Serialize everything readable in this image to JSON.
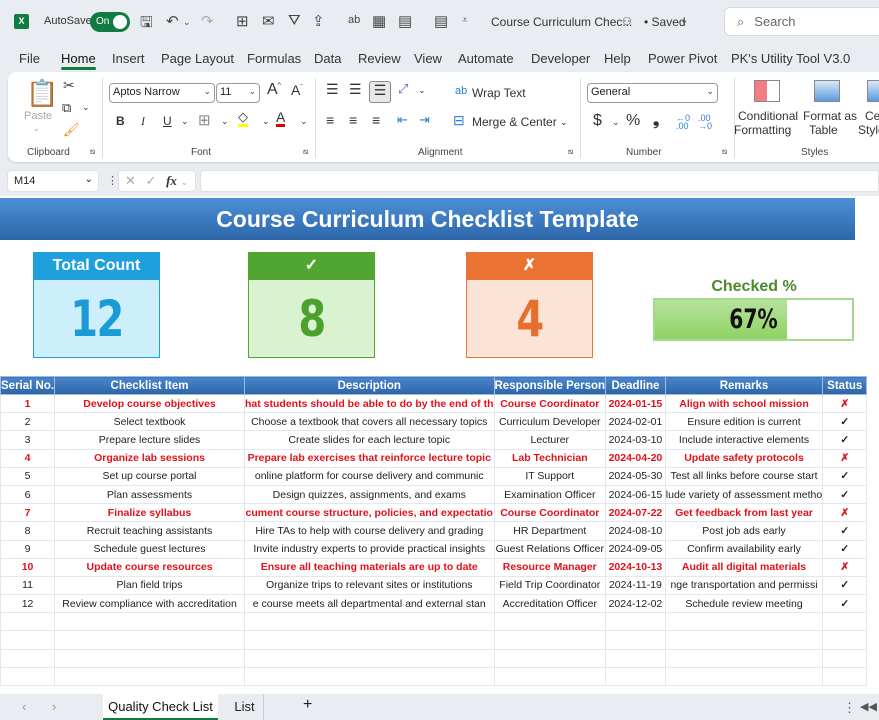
{
  "titlebar": {
    "app_logo": "X",
    "autosave_label": "AutoSave",
    "autosave_state": "On",
    "doc_title": "Course Curriculum Chec...",
    "saved_label": "• Saved",
    "search_placeholder": "Search",
    "qat_icons": [
      "save-icon",
      "undo-icon",
      "redo-icon",
      "borders-icon",
      "camera-icon",
      "filter-icon",
      "share-icon",
      "spelling-icon",
      "table-icon",
      "calculator-icon",
      "calculator-icon",
      "customize-qat-icon"
    ]
  },
  "menu": {
    "tabs": [
      "File",
      "Home",
      "Insert",
      "Page Layout",
      "Formulas",
      "Data",
      "Review",
      "View",
      "Automate",
      "Developer",
      "Help",
      "Power Pivot",
      "PK's Utility Tool V3.0"
    ],
    "active": "Home"
  },
  "ribbon": {
    "clipboard": {
      "paste_label": "Paste",
      "group_label": "Clipboard"
    },
    "font": {
      "font_name": "Aptos Narrow",
      "font_size": "11",
      "bold": "B",
      "italic": "I",
      "underline": "U",
      "group_label": "Font",
      "highlight_color": "#ffff00",
      "font_color": "#e00000"
    },
    "alignment": {
      "wrap_text": "Wrap Text",
      "merge_center": "Merge & Center",
      "group_label": "Alignment"
    },
    "number": {
      "format": "General",
      "currency": "$",
      "percent": "%",
      "comma": "❟",
      "group_label": "Number"
    },
    "styles": {
      "conditional_formatting_1": "Conditional",
      "conditional_formatting_2": "Formatting",
      "format_as_table_1": "Format as",
      "format_as_table_2": "Table",
      "cell_styles_1": "Ce",
      "cell_styles_2": "Style",
      "group_label": "Styles"
    }
  },
  "formula_bar": {
    "name_box": "M14",
    "formula": ""
  },
  "sheet": {
    "title": "Course Curriculum Checklist Template",
    "kpis": [
      {
        "label": "Total Count",
        "value": "12",
        "head_color": "#1fa0dc",
        "body_color": "#cdeefb",
        "text_color": "#1a9bd7"
      },
      {
        "label": "✓",
        "value": "8",
        "head_color": "#50a630",
        "body_color": "#d9f2d0",
        "text_color": "#4aa22c"
      },
      {
        "label": "✗",
        "value": "4",
        "head_color": "#ea7333",
        "body_color": "#fbe3d6",
        "text_color": "#e76f2e"
      }
    ],
    "checked_pct": {
      "label": "Checked %",
      "value": "67%",
      "fraction": 0.67
    },
    "table": {
      "columns": [
        "Serial No.",
        "Checklist Item",
        "Description",
        "Responsible Person",
        "Deadline",
        "Remarks",
        "Status"
      ],
      "rows": [
        {
          "no": "1",
          "item": "Develop course objectives",
          "desc": "hat students should be able to do by the end of th",
          "person": "Course Coordinator",
          "deadline": "2024-01-15",
          "remarks": "Align with school mission",
          "status": "✗",
          "done": false
        },
        {
          "no": "2",
          "item": "Select textbook",
          "desc": "Choose a textbook that covers all necessary topics",
          "person": "Curriculum Developer",
          "deadline": "2024-02-01",
          "remarks": "Ensure edition is current",
          "status": "✓",
          "done": true
        },
        {
          "no": "3",
          "item": "Prepare lecture slides",
          "desc": "Create slides for each lecture topic",
          "person": "Lecturer",
          "deadline": "2024-03-10",
          "remarks": "Include interactive elements",
          "status": "✓",
          "done": true
        },
        {
          "no": "4",
          "item": "Organize lab sessions",
          "desc": "Prepare lab exercises that reinforce lecture topic",
          "person": "Lab Technician",
          "deadline": "2024-04-20",
          "remarks": "Update safety protocols",
          "status": "✗",
          "done": false
        },
        {
          "no": "5",
          "item": "Set up course portal",
          "desc": "online platform for course delivery and communic",
          "person": "IT Support",
          "deadline": "2024-05-30",
          "remarks": "Test all links before course start",
          "status": "✓",
          "done": true
        },
        {
          "no": "6",
          "item": "Plan assessments",
          "desc": "Design quizzes, assignments, and exams",
          "person": "Examination Officer",
          "deadline": "2024-06-15",
          "remarks": "lude variety of assessment metho",
          "status": "✓",
          "done": true
        },
        {
          "no": "7",
          "item": "Finalize syllabus",
          "desc": "cument course structure, policies, and expectatio",
          "person": "Course Coordinator",
          "deadline": "2024-07-22",
          "remarks": "Get feedback from last year",
          "status": "✗",
          "done": false
        },
        {
          "no": "8",
          "item": "Recruit teaching assistants",
          "desc": "Hire TAs to help with course delivery and grading",
          "person": "HR Department",
          "deadline": "2024-08-10",
          "remarks": "Post job ads early",
          "status": "✓",
          "done": true
        },
        {
          "no": "9",
          "item": "Schedule guest lectures",
          "desc": "Invite industry experts to provide practical insights",
          "person": "Guest Relations Officer",
          "deadline": "2024-09-05",
          "remarks": "Confirm availability early",
          "status": "✓",
          "done": true
        },
        {
          "no": "10",
          "item": "Update course resources",
          "desc": "Ensure all teaching materials are up to date",
          "person": "Resource Manager",
          "deadline": "2024-10-13",
          "remarks": "Audit all digital materials",
          "status": "✗",
          "done": false
        },
        {
          "no": "11",
          "item": "Plan field trips",
          "desc": "Organize trips to relevant sites or institutions",
          "person": "Field Trip Coordinator",
          "deadline": "2024-11-19",
          "remarks": "nge transportation and permissi",
          "status": "✓",
          "done": true
        },
        {
          "no": "12",
          "item": "Review compliance with accreditation",
          "desc": "e course meets all departmental and external stan",
          "person": "Accreditation Officer",
          "deadline": "2024-12-02",
          "remarks": "Schedule review meeting",
          "status": "✓",
          "done": true
        }
      ],
      "empty_rows": 4
    }
  },
  "sheet_tabs": {
    "tabs": [
      "Quality Check List",
      "List"
    ],
    "active": "Quality Check List",
    "add_label": "+"
  }
}
